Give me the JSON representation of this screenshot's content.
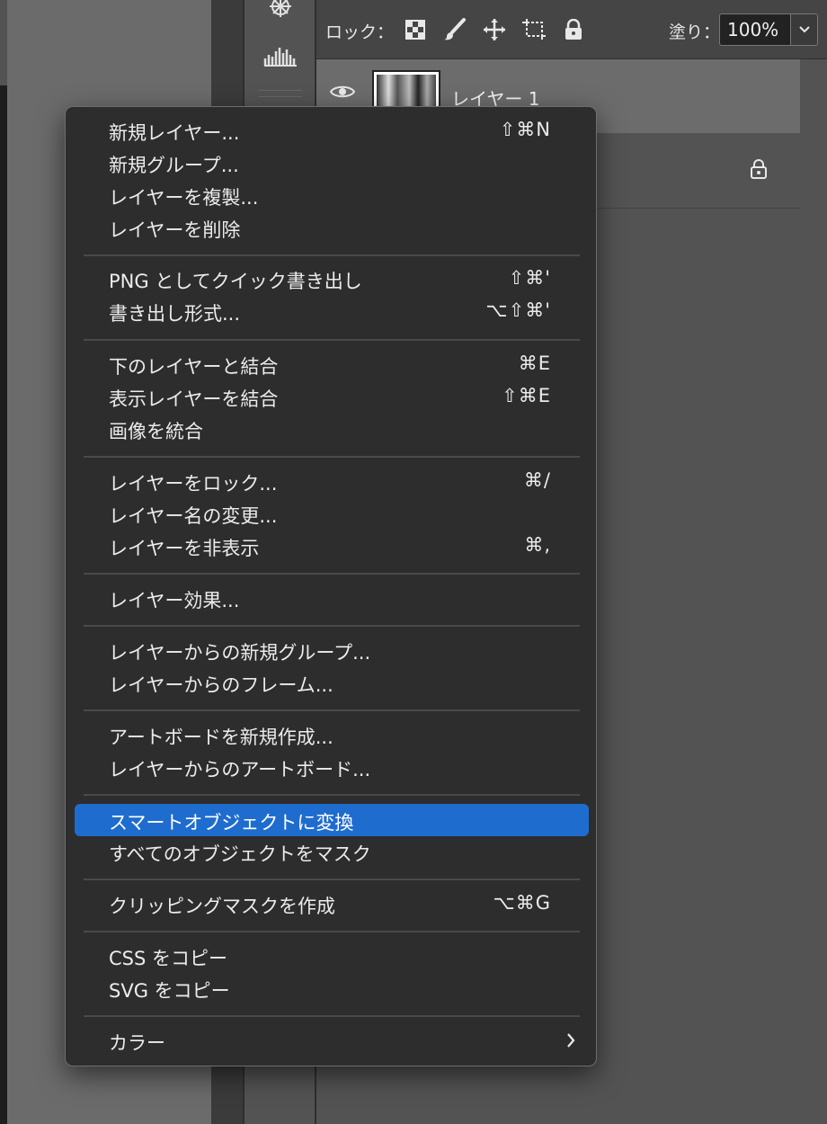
{
  "layers_panel": {
    "lock_label": "ロック：",
    "fill_label": "塗り：",
    "fill_value": "100%",
    "layers": [
      {
        "name": "レイヤー 1"
      }
    ]
  },
  "menu": {
    "groups": [
      [
        {
          "label": "新規レイヤー...",
          "shortcut": "⇧⌘N"
        },
        {
          "label": "新規グループ...",
          "shortcut": ""
        },
        {
          "label": "レイヤーを複製...",
          "shortcut": ""
        },
        {
          "label": "レイヤーを削除",
          "shortcut": ""
        }
      ],
      [
        {
          "label": "PNG としてクイック書き出し",
          "shortcut": "⇧⌘'"
        },
        {
          "label": "書き出し形式...",
          "shortcut": "⌥⇧⌘'"
        }
      ],
      [
        {
          "label": "下のレイヤーと結合",
          "shortcut": "⌘E"
        },
        {
          "label": "表示レイヤーを結合",
          "shortcut": "⇧⌘E"
        },
        {
          "label": "画像を統合",
          "shortcut": ""
        }
      ],
      [
        {
          "label": "レイヤーをロック...",
          "shortcut": "⌘/"
        },
        {
          "label": "レイヤー名の変更...",
          "shortcut": ""
        },
        {
          "label": "レイヤーを非表示",
          "shortcut": "⌘,"
        }
      ],
      [
        {
          "label": "レイヤー効果...",
          "shortcut": ""
        }
      ],
      [
        {
          "label": "レイヤーからの新規グループ...",
          "shortcut": ""
        },
        {
          "label": "レイヤーからのフレーム...",
          "shortcut": ""
        }
      ],
      [
        {
          "label": "アートボードを新規作成...",
          "shortcut": ""
        },
        {
          "label": "レイヤーからのアートボード...",
          "shortcut": ""
        }
      ],
      [
        {
          "label": "スマートオブジェクトに変換",
          "shortcut": ""
        },
        {
          "label": "すべてのオブジェクトをマスク",
          "shortcut": ""
        }
      ],
      [
        {
          "label": "クリッピングマスクを作成",
          "shortcut": "⌥⌘G"
        }
      ],
      [
        {
          "label": "CSS をコピー",
          "shortcut": ""
        },
        {
          "label": "SVG をコピー",
          "shortcut": ""
        }
      ],
      [
        {
          "label": "カラー",
          "shortcut": ""
        }
      ]
    ],
    "highlighted_item": "スマートオブジェクトに変換",
    "highlight_color": "#1f6ccf"
  },
  "icons": [
    "compass-icon",
    "histogram-icon",
    "eye-icon",
    "lock-icon",
    "brush-icon",
    "move-icon",
    "artboard-icon",
    "transparency-grid-icon",
    "chevron-down-icon",
    "chevron-right-icon"
  ]
}
